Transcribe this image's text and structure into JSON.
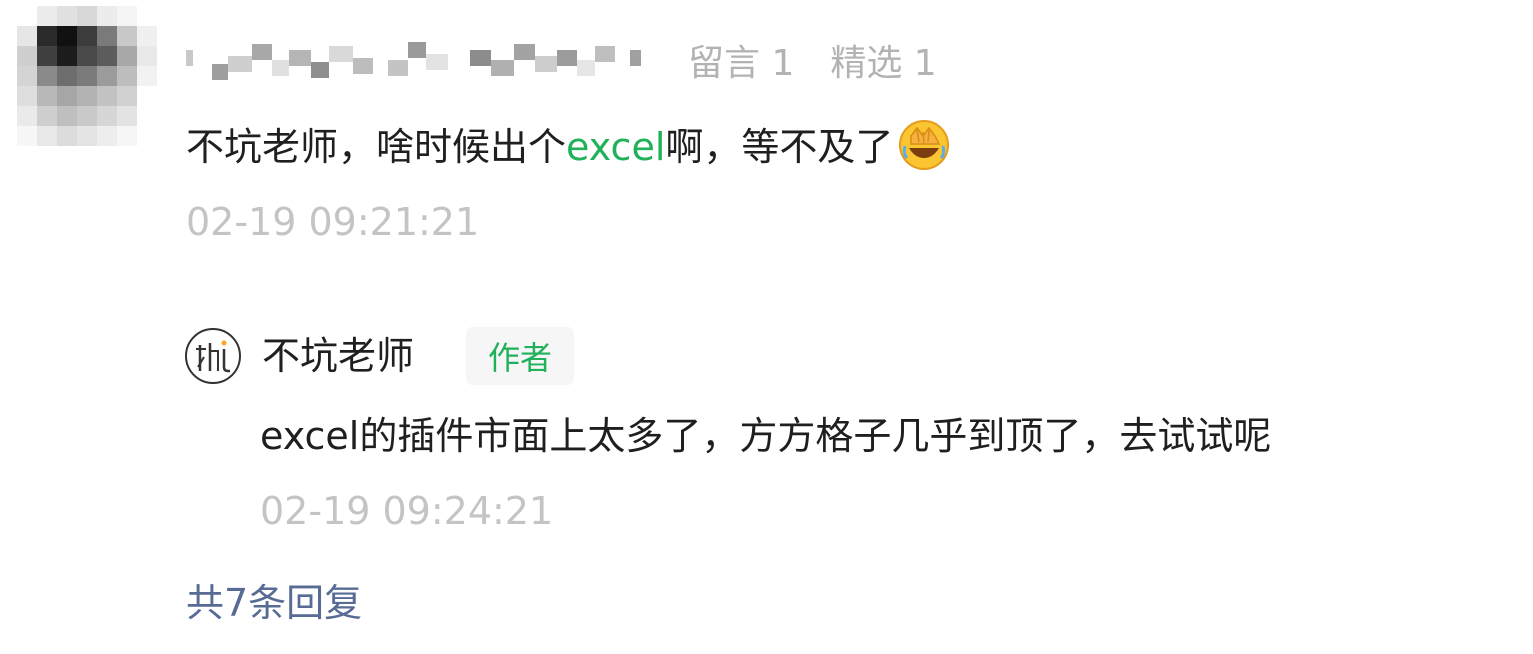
{
  "header": {
    "comments_label": "留言 1",
    "featured_label": "精选 1"
  },
  "comment": {
    "text_before": "不坑老师，啥时候出个",
    "highlight": "excel",
    "text_after": "啊，等不及了",
    "emoji": "facepalm-emoji",
    "time": "02-19 09:21:21"
  },
  "reply": {
    "author_name": "不坑老师",
    "badge": "作者",
    "text": "excel的插件市面上太多了，方方格子几乎到顶了，去试试呢",
    "time": "02-19 09:24:21"
  },
  "more_replies_label": "共7条回复",
  "colors": {
    "highlight": "#20b15a",
    "link": "#576b95",
    "muted": "#c4c4c4"
  }
}
